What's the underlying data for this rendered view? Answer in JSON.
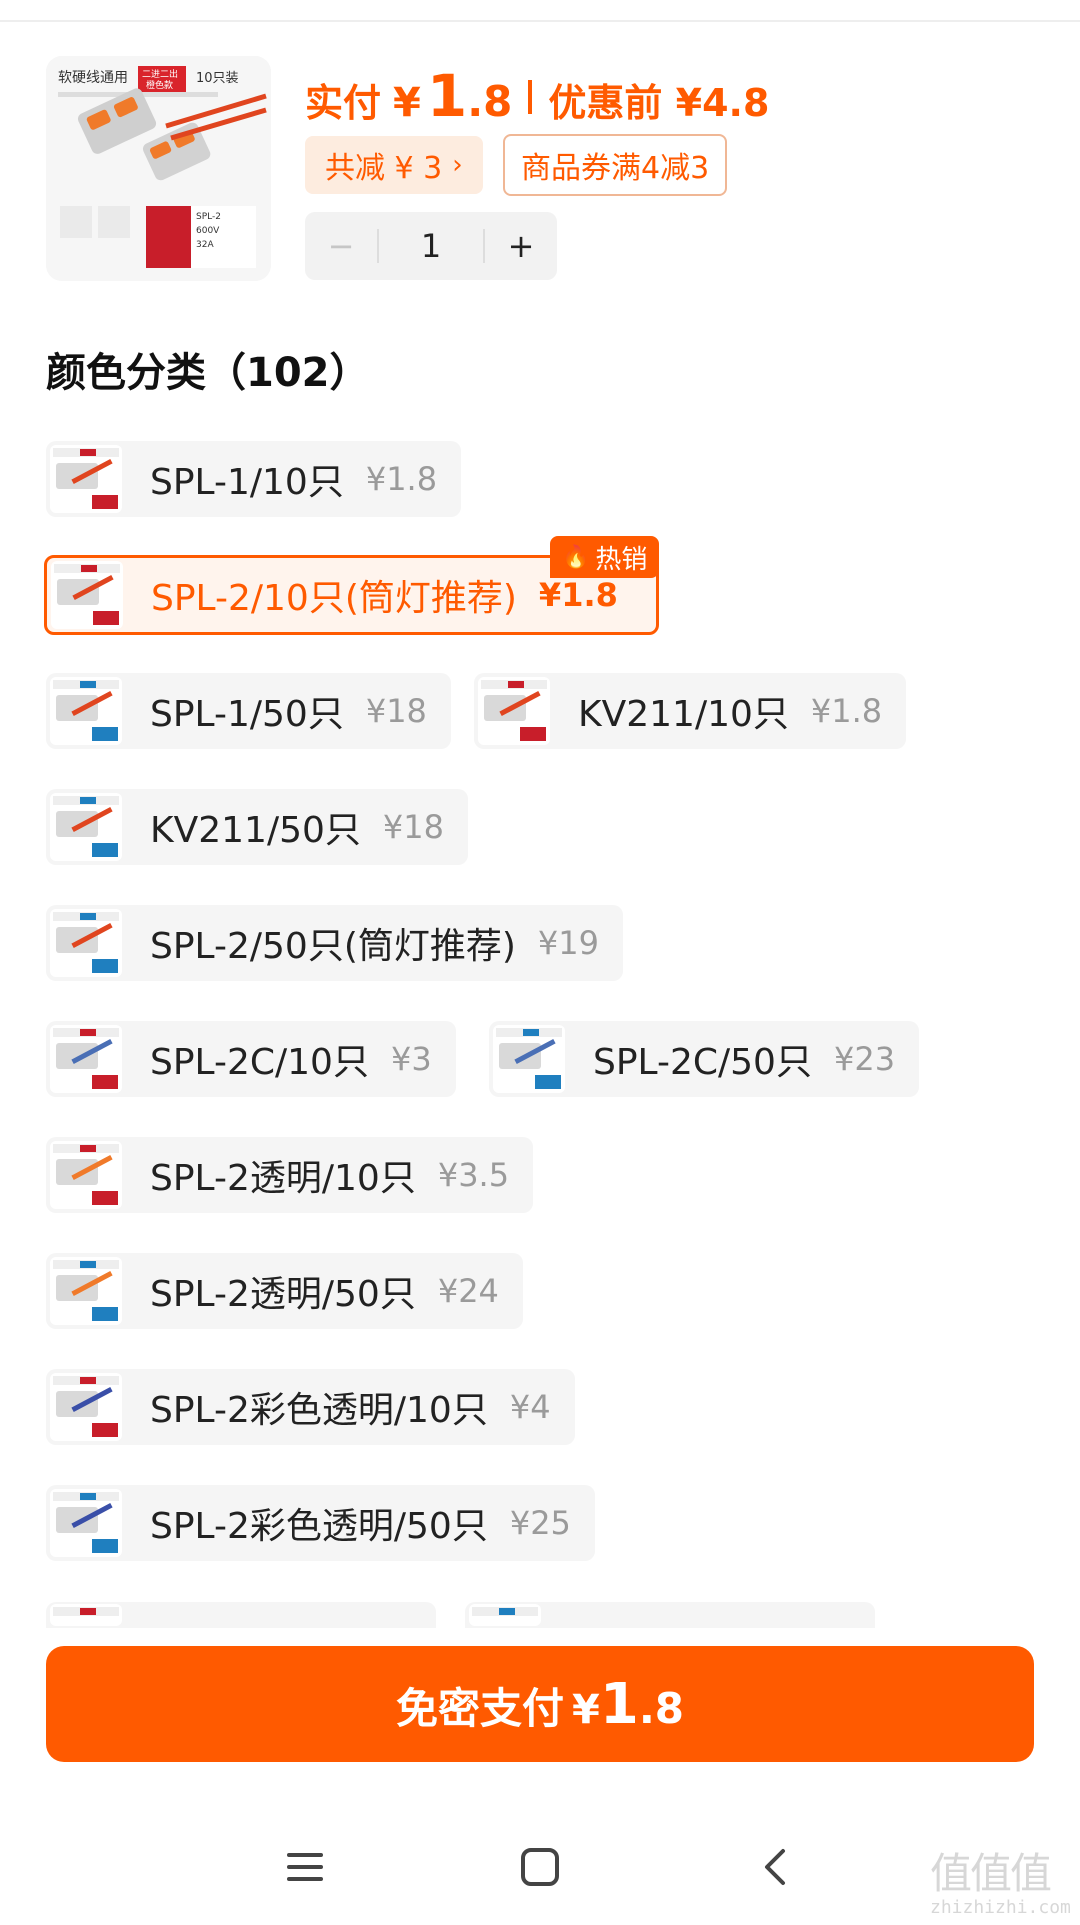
{
  "product": {
    "price_prefix": "实付",
    "currency": "¥",
    "price_int": "1",
    "price_dec": ".8",
    "orig_label": "优惠前 ¥4.8",
    "discount_label": "共减 ¥ 3",
    "coupon_label": "商品券满4减3",
    "quantity": "1",
    "minus": "−",
    "plus": "+",
    "thumb_texts": [
      "软硬线通用",
      "二进二出",
      "橙色款",
      "10只装",
      "SPL-2",
      "600V",
      "32A"
    ]
  },
  "section": {
    "title": "颜色分类（102）"
  },
  "hot_badge": "热销",
  "variants": [
    {
      "name": "SPL-1/10只",
      "price": "¥1.8",
      "accent": "#c81e2a"
    },
    {
      "name": "SPL-2/10只(筒灯推荐)",
      "price": "¥1.8",
      "accent": "#c81e2a",
      "selected": true
    },
    {
      "name": "SPL-1/50只",
      "price": "¥18",
      "accent": "#1f7fbf"
    },
    {
      "name": "KV211/10只",
      "price": "¥1.8",
      "accent": "#c81e2a"
    },
    {
      "name": "KV211/50只",
      "price": "¥18",
      "accent": "#1f7fbf"
    },
    {
      "name": "SPL-2/50只(筒灯推荐)",
      "price": "¥19",
      "accent": "#1f7fbf"
    },
    {
      "name": "SPL-2C/10只",
      "price": "¥3",
      "accent": "#c81e2a"
    },
    {
      "name": "SPL-2C/50只",
      "price": "¥23",
      "accent": "#1f7fbf"
    },
    {
      "name": "SPL-2透明/10只",
      "price": "¥3.5",
      "accent": "#c81e2a"
    },
    {
      "name": "SPL-2透明/50只",
      "price": "¥24",
      "accent": "#1f7fbf"
    },
    {
      "name": "SPL-2彩色透明/10只",
      "price": "¥4",
      "accent": "#c81e2a"
    },
    {
      "name": "SPL-2彩色透明/50只",
      "price": "¥25",
      "accent": "#1f7fbf"
    }
  ],
  "pay": {
    "label": "免密支付",
    "currency": "¥",
    "int": "1",
    "dec": ".8"
  },
  "colors": {
    "accent": "#ff5a00",
    "chip_bg": "#f5f5f5"
  },
  "nav": {
    "icons": [
      "menu-icon",
      "home-icon",
      "back-icon"
    ]
  },
  "watermark": {
    "mark": "值值值",
    "site": "zhizhizhi.com"
  }
}
